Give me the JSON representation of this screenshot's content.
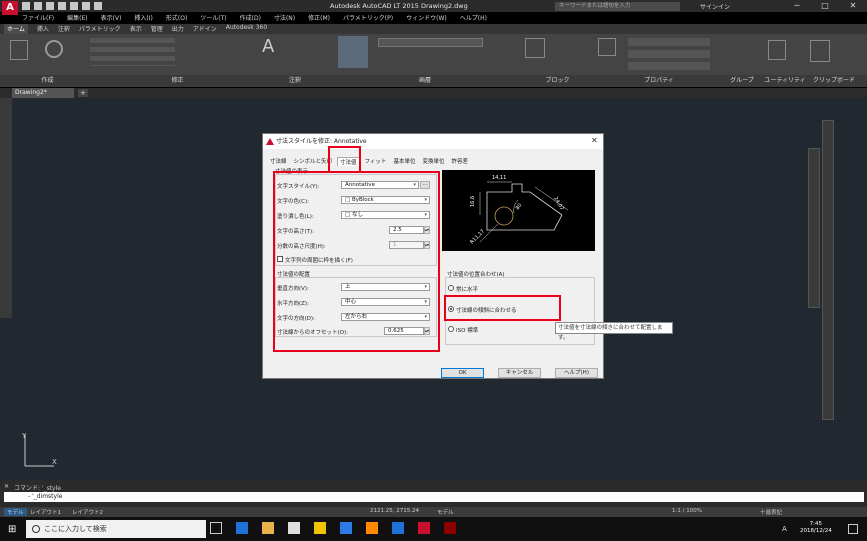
{
  "app": {
    "title": "Autodesk AutoCAD LT 2015   Drawing2.dwg",
    "search_placeholder": "キーワードまたは語句を入力",
    "signin": "サインイン",
    "logo_letter": "A"
  },
  "menu": [
    "ファイル(F)",
    "編集(E)",
    "表示(V)",
    "挿入(I)",
    "形式(O)",
    "ツール(T)",
    "作成(D)",
    "寸法(N)",
    "修正(M)",
    "パラメトリック(P)",
    "ウィンドウ(W)",
    "ヘルプ(H)"
  ],
  "ribbon_tabs": [
    "ホーム",
    "挿入",
    "注釈",
    "パラメトリック",
    "表示",
    "管理",
    "出力",
    "アドイン",
    "Autodesk 360"
  ],
  "ribbon_panels": [
    "作成",
    "修正",
    "注釈",
    "画層",
    "ブロック",
    "プロパティ",
    "グループ",
    "ユーティリティ",
    "クリップボード"
  ],
  "doc_tab": "Drawing2*",
  "dialog": {
    "title": "寸法スタイルを修正: Annotative",
    "tabs": [
      "寸法線",
      "シンボルと矢印",
      "寸法値",
      "フィット",
      "基本単位",
      "変換単位",
      "許容差"
    ],
    "active_tab": "寸法値",
    "appearance_group": "寸法値の表示",
    "text_style_label": "文字スタイル(Y):",
    "text_style_value": "Annotative",
    "text_color_label": "文字の色(C):",
    "text_color_value": "ByBlock",
    "fill_color_label": "塗り潰し色(L):",
    "fill_color_value": "なし",
    "text_height_label": "文字の高さ(T):",
    "text_height_value": "2.5",
    "fraction_label": "分数の高さ尺度(H):",
    "fraction_value": "1",
    "frame_label": "文字列の周囲に枠を描く(F)",
    "placement_group": "寸法値の配置",
    "vertical_label": "垂直方向(V):",
    "vertical_value": "上",
    "horizontal_label": "水平方向(Z):",
    "horizontal_value": "中心",
    "view_dir_label": "文字の方向(D):",
    "view_dir_value": "左から右",
    "offset_label": "寸法線からのオフセット(O):",
    "offset_value": "0.625",
    "alignment_group": "寸法値の位置合わせ(A)",
    "align_options": [
      "常に水平",
      "寸法線の傾斜に合わせる",
      "ISO 標準"
    ],
    "ok": "OK",
    "cancel": "キャンセル",
    "help": "ヘルプ(H)",
    "preview_dims": [
      "14,11",
      "16,6",
      "80",
      "R11,17",
      "24,07"
    ]
  },
  "tooltip": "寸法値を寸法線の傾きに合わせて配置します。",
  "command": {
    "history": "コマンド: '_style",
    "current": "- '_dimstyle"
  },
  "status": {
    "layout_tabs": [
      "モデル",
      "レイアウト1",
      "レイアウト2"
    ],
    "coords": "2121.25, 2715.24",
    "space": "モデル",
    "scale": "1:1 / 100%",
    "notation": "十進表記"
  },
  "taskbar": {
    "search": "ここに入力して検索",
    "time": "7:45",
    "date": "2018/12/24",
    "ime": "A"
  }
}
